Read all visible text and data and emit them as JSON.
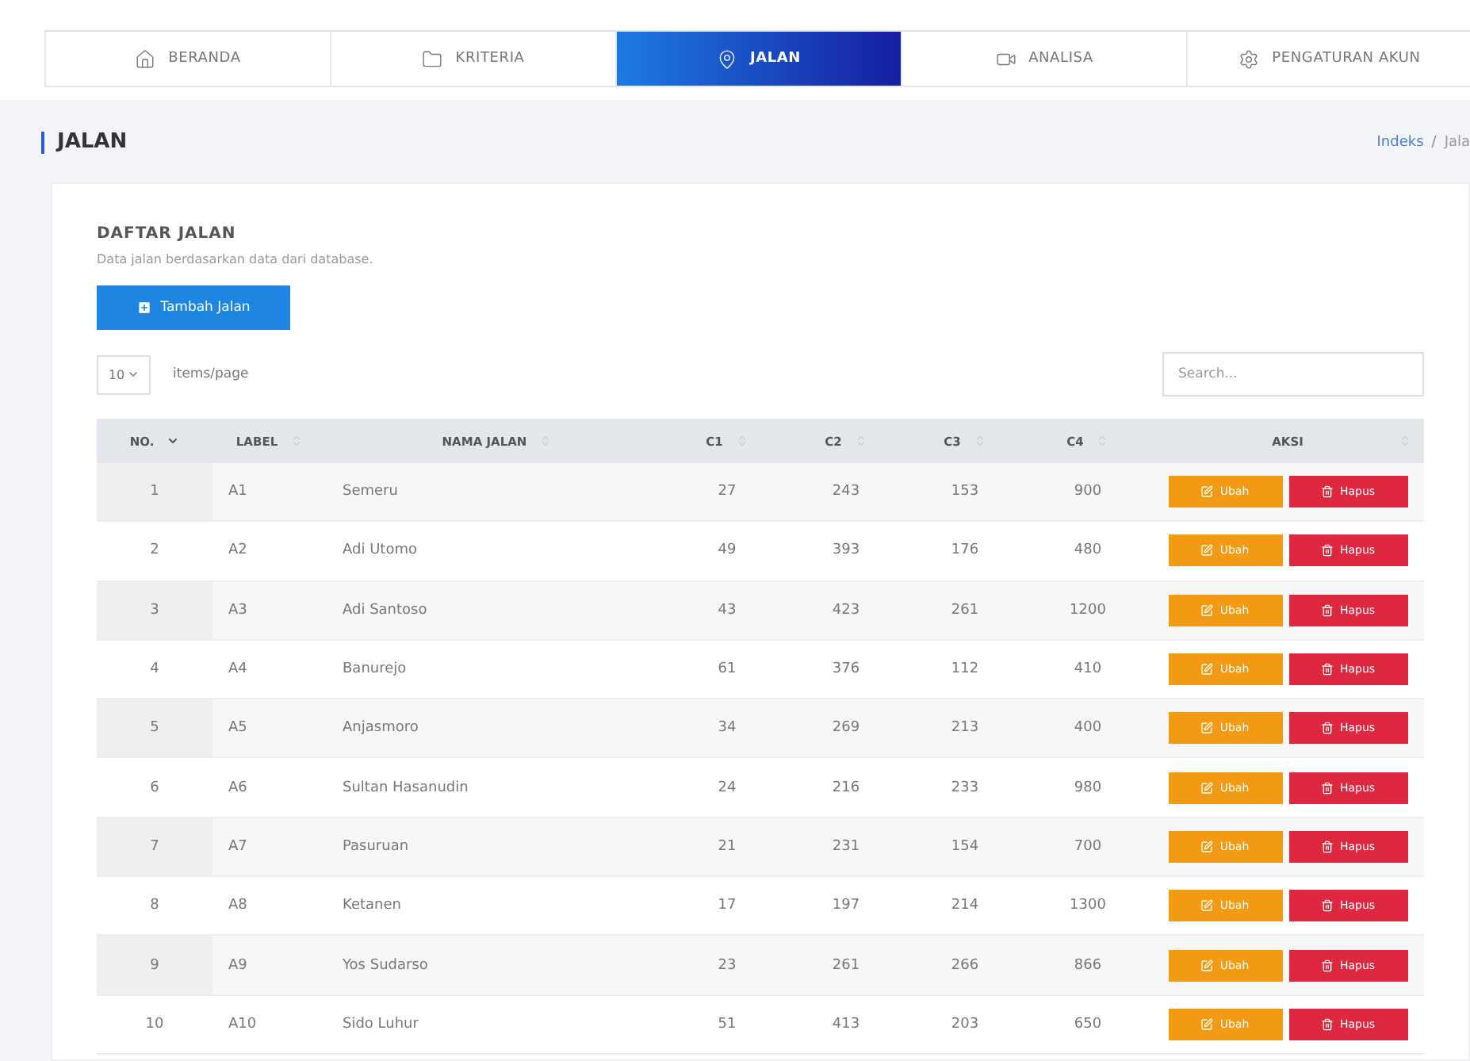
{
  "nav": [
    {
      "label": "BERANDA",
      "selected": false
    },
    {
      "label": "KRITERIA",
      "selected": false
    },
    {
      "label": "JALAN",
      "selected": true
    },
    {
      "label": "ANALISA",
      "selected": false
    },
    {
      "label": "PENGATURAN AKUN",
      "selected": false
    }
  ],
  "page_title": "JALAN",
  "breadcrumb": [
    "Indeks",
    "/",
    "Jala"
  ],
  "card": {
    "title": "DAFTAR JALAN",
    "subtitle": "Data jalan berdasarkan data dari database.",
    "add_button": "Tambah Jalan",
    "page_size": "10",
    "page_size_label": "items/page",
    "search_placeholder": "Search..."
  },
  "table": {
    "columns": [
      "NO.",
      "LABEL",
      "NAMA JALAN",
      "C1",
      "C2",
      "C3",
      "C4",
      "AKSI"
    ],
    "rows": [
      {
        "no": "1",
        "label": "A1",
        "name": "Semeru",
        "c1": "27",
        "c2": "243",
        "c3": "153",
        "c4": "900",
        "edit": "Ubah",
        "delete": "Hapus"
      },
      {
        "no": "2",
        "label": "A2",
        "name": "Adi Utomo",
        "c1": "49",
        "c2": "393",
        "c3": "176",
        "c4": "480",
        "edit": "Ubah",
        "delete": "Hapus"
      },
      {
        "no": "3",
        "label": "A3",
        "name": "Adi Santoso",
        "c1": "43",
        "c2": "423",
        "c3": "261",
        "c4": "1200",
        "edit": "Ubah",
        "delete": "Hapus"
      },
      {
        "no": "4",
        "label": "A4",
        "name": "Banurejo",
        "c1": "61",
        "c2": "376",
        "c3": "112",
        "c4": "410",
        "edit": "Ubah",
        "delete": "Hapus"
      },
      {
        "no": "5",
        "label": "A5",
        "name": "Anjasmoro",
        "c1": "34",
        "c2": "269",
        "c3": "213",
        "c4": "400",
        "edit": "Ubah",
        "delete": "Hapus"
      },
      {
        "no": "6",
        "label": "A6",
        "name": "Sultan Hasanudin",
        "c1": "24",
        "c2": "216",
        "c3": "233",
        "c4": "980",
        "edit": "Ubah",
        "delete": "Hapus"
      },
      {
        "no": "7",
        "label": "A7",
        "name": "Pasuruan",
        "c1": "21",
        "c2": "231",
        "c3": "154",
        "c4": "700",
        "edit": "Ubah",
        "delete": "Hapus"
      },
      {
        "no": "8",
        "label": "A8",
        "name": "Ketanen",
        "c1": "17",
        "c2": "197",
        "c3": "214",
        "c4": "1300",
        "edit": "Ubah",
        "delete": "Hapus"
      },
      {
        "no": "9",
        "label": "A9",
        "name": "Yos Sudarso",
        "c1": "23",
        "c2": "261",
        "c3": "266",
        "c4": "866",
        "edit": "Ubah",
        "delete": "Hapus"
      },
      {
        "no": "10",
        "label": "A10",
        "name": "Sido Luhur",
        "c1": "51",
        "c2": "413",
        "c3": "203",
        "c4": "650",
        "edit": "Ubah",
        "delete": "Hapus"
      }
    ]
  }
}
